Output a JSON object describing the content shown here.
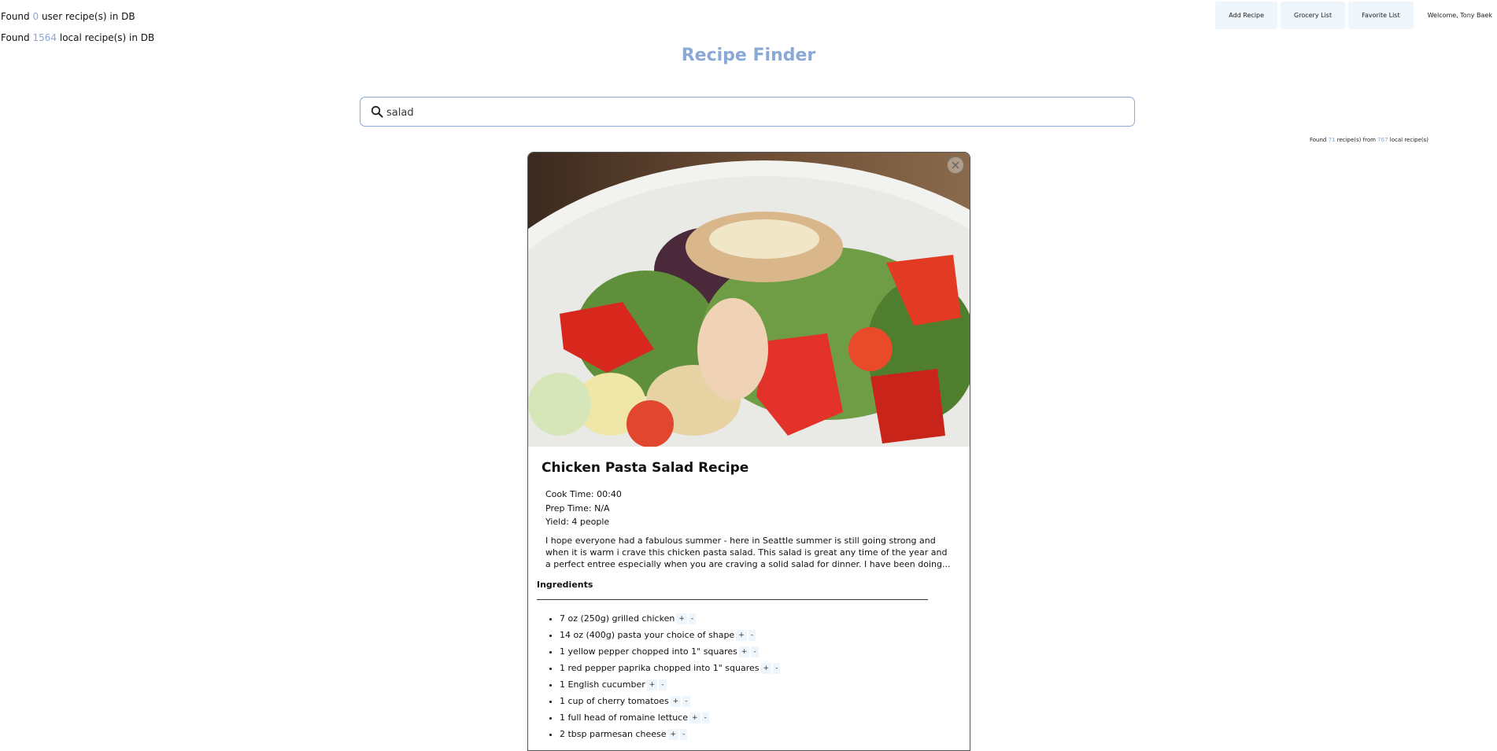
{
  "stats": {
    "user_prefix": "Found",
    "user_count": "0",
    "user_suffix": "user recipe(s) in DB",
    "local_prefix": "Found",
    "local_count": "1564",
    "local_suffix": "local recipe(s) in DB"
  },
  "nav": {
    "add_recipe": "Add Recipe",
    "grocery_list": "Grocery List",
    "favorite_list": "Favorite List",
    "welcome": "Welcome, Tony Baek"
  },
  "title": "Recipe Finder",
  "search": {
    "value": "salad"
  },
  "results": {
    "prefix": "Found",
    "count": "71",
    "middle": "recipe(s) from",
    "total": "767",
    "suffix": "local recipe(s)"
  },
  "recipe": {
    "title": "Chicken Pasta Salad Recipe",
    "cook_time": "Cook Time: 00:40",
    "prep_time": "Prep Time: N/A",
    "yield": "Yield: 4 people",
    "description": "I hope everyone had a fabulous summer - here in Seattle summer is still going strong and when it is warm i crave this chicken pasta salad.   This salad is great any time of the year and a perfect entree especially when you are craving a solid salad for dinner.   I have been doing...",
    "ingredients_heading": "Ingredients",
    "plus": "+",
    "minus": "-",
    "ingredients": [
      "7 oz (250g) grilled chicken",
      "14 oz (400g) pasta your choice of shape",
      "1 yellow pepper chopped into 1\" squares",
      "1 red pepper paprika chopped into 1\" squares",
      "1 English cucumber",
      "1 cup of cherry tomatoes",
      "1 full head of romaine lettuce",
      "2 tbsp parmesan cheese"
    ]
  },
  "colors": {
    "accent": "#8aa9d6",
    "button_bg": "#eef5fb"
  }
}
